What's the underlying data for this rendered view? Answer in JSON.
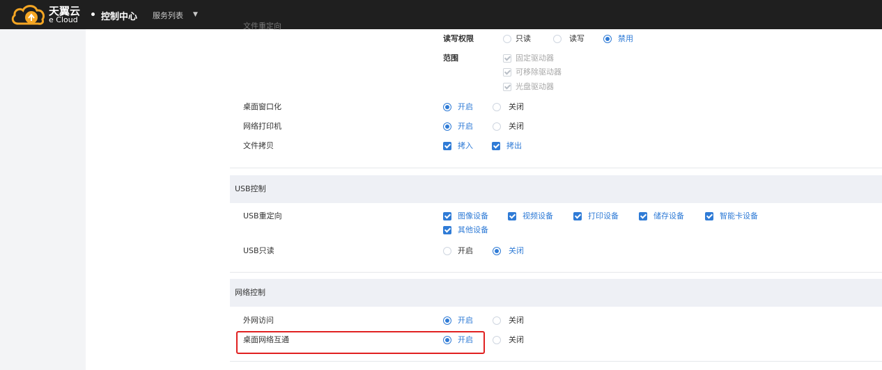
{
  "header": {
    "logo_cn": "天翼云",
    "logo_en": "e Cloud",
    "console": "控制中心",
    "service_list": "服务列表"
  },
  "file_redirect": {
    "partial_label": "文件重定向",
    "rw_label": "读写权限",
    "rw_options": [
      "只读",
      "读写",
      "禁用"
    ],
    "rw_selected": "禁用",
    "scope_label": "范围",
    "scope_options": [
      "固定驱动器",
      "可移除驱动器",
      "光盘驱动器"
    ]
  },
  "settings": {
    "window_label": "桌面窗口化",
    "printer_label": "网络打印机",
    "copy_label": "文件拷贝",
    "on": "开启",
    "off": "关闭",
    "copy_in": "拷入",
    "copy_out": "拷出"
  },
  "usb": {
    "title": "USB控制",
    "redirect_label": "USB重定向",
    "devices": [
      "图像设备",
      "视频设备",
      "打印设备",
      "储存设备",
      "智能卡设备",
      "其他设备"
    ],
    "readonly_label": "USB只读",
    "readonly_selected": "关闭"
  },
  "network": {
    "title": "网络控制",
    "external_label": "外网访问",
    "external_selected": "开启",
    "interconnect_label": "桌面网络互通",
    "interconnect_selected": "开启"
  },
  "colors": {
    "accent": "#2f7bd6",
    "topbar": "#1f1f1f",
    "highlight": "#e02020",
    "section_bg": "#eef0f5"
  }
}
